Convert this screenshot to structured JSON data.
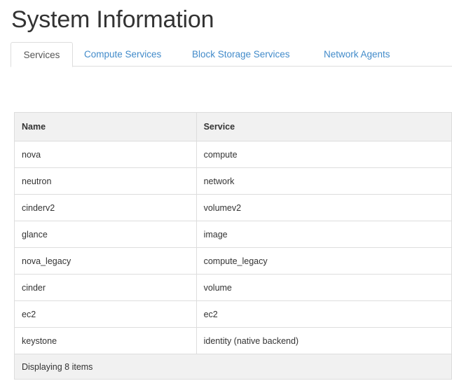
{
  "page": {
    "title": "System Information"
  },
  "tabs": [
    {
      "label": "Services",
      "active": true
    },
    {
      "label": "Compute Services",
      "active": false
    },
    {
      "label": "Block Storage Services",
      "active": false
    },
    {
      "label": "Network Agents",
      "active": false
    }
  ],
  "table": {
    "columns": [
      "Name",
      "Service"
    ],
    "rows": [
      {
        "name": "nova",
        "service": "compute"
      },
      {
        "name": "neutron",
        "service": "network"
      },
      {
        "name": "cinderv2",
        "service": "volumev2"
      },
      {
        "name": "glance",
        "service": "image"
      },
      {
        "name": "nova_legacy",
        "service": "compute_legacy"
      },
      {
        "name": "cinder",
        "service": "volume"
      },
      {
        "name": "ec2",
        "service": "ec2"
      },
      {
        "name": "keystone",
        "service": "identity (native backend)"
      }
    ],
    "footer": "Displaying 8 items"
  },
  "colors": {
    "link": "#428bca",
    "text": "#333333",
    "header_bg": "#f1f1f1",
    "border": "#dddddd"
  }
}
